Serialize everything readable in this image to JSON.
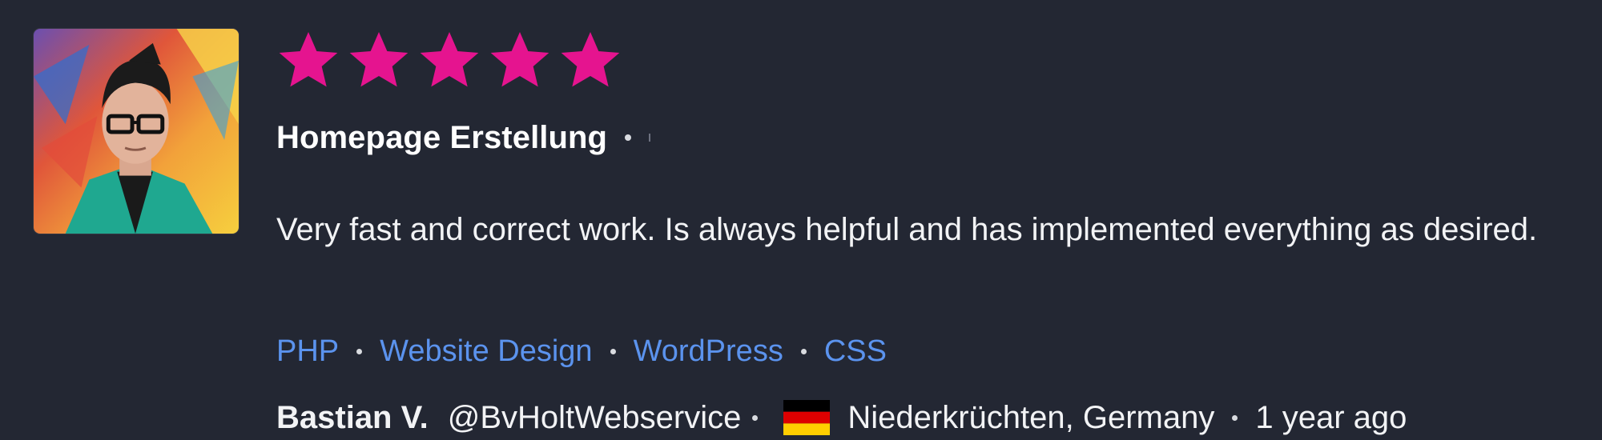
{
  "review": {
    "rating": 5,
    "rating_max": 5,
    "project_title": "Homepage Erstellung",
    "text": "Very fast and correct work. Is always helpful and has implemented everything as desired.",
    "skills": [
      "PHP",
      "Website Design",
      "WordPress",
      "CSS"
    ],
    "author": {
      "name": "Bastian V.",
      "handle": "@BvHoltWebservice",
      "location": "Niederkrüchten, Germany",
      "country_flag": "germany-flag-icon",
      "time_ago": "1 year ago"
    }
  },
  "colors": {
    "background": "#232733",
    "star": "#e5148f",
    "link": "#5b93ee",
    "text": "#f2f3f5"
  }
}
